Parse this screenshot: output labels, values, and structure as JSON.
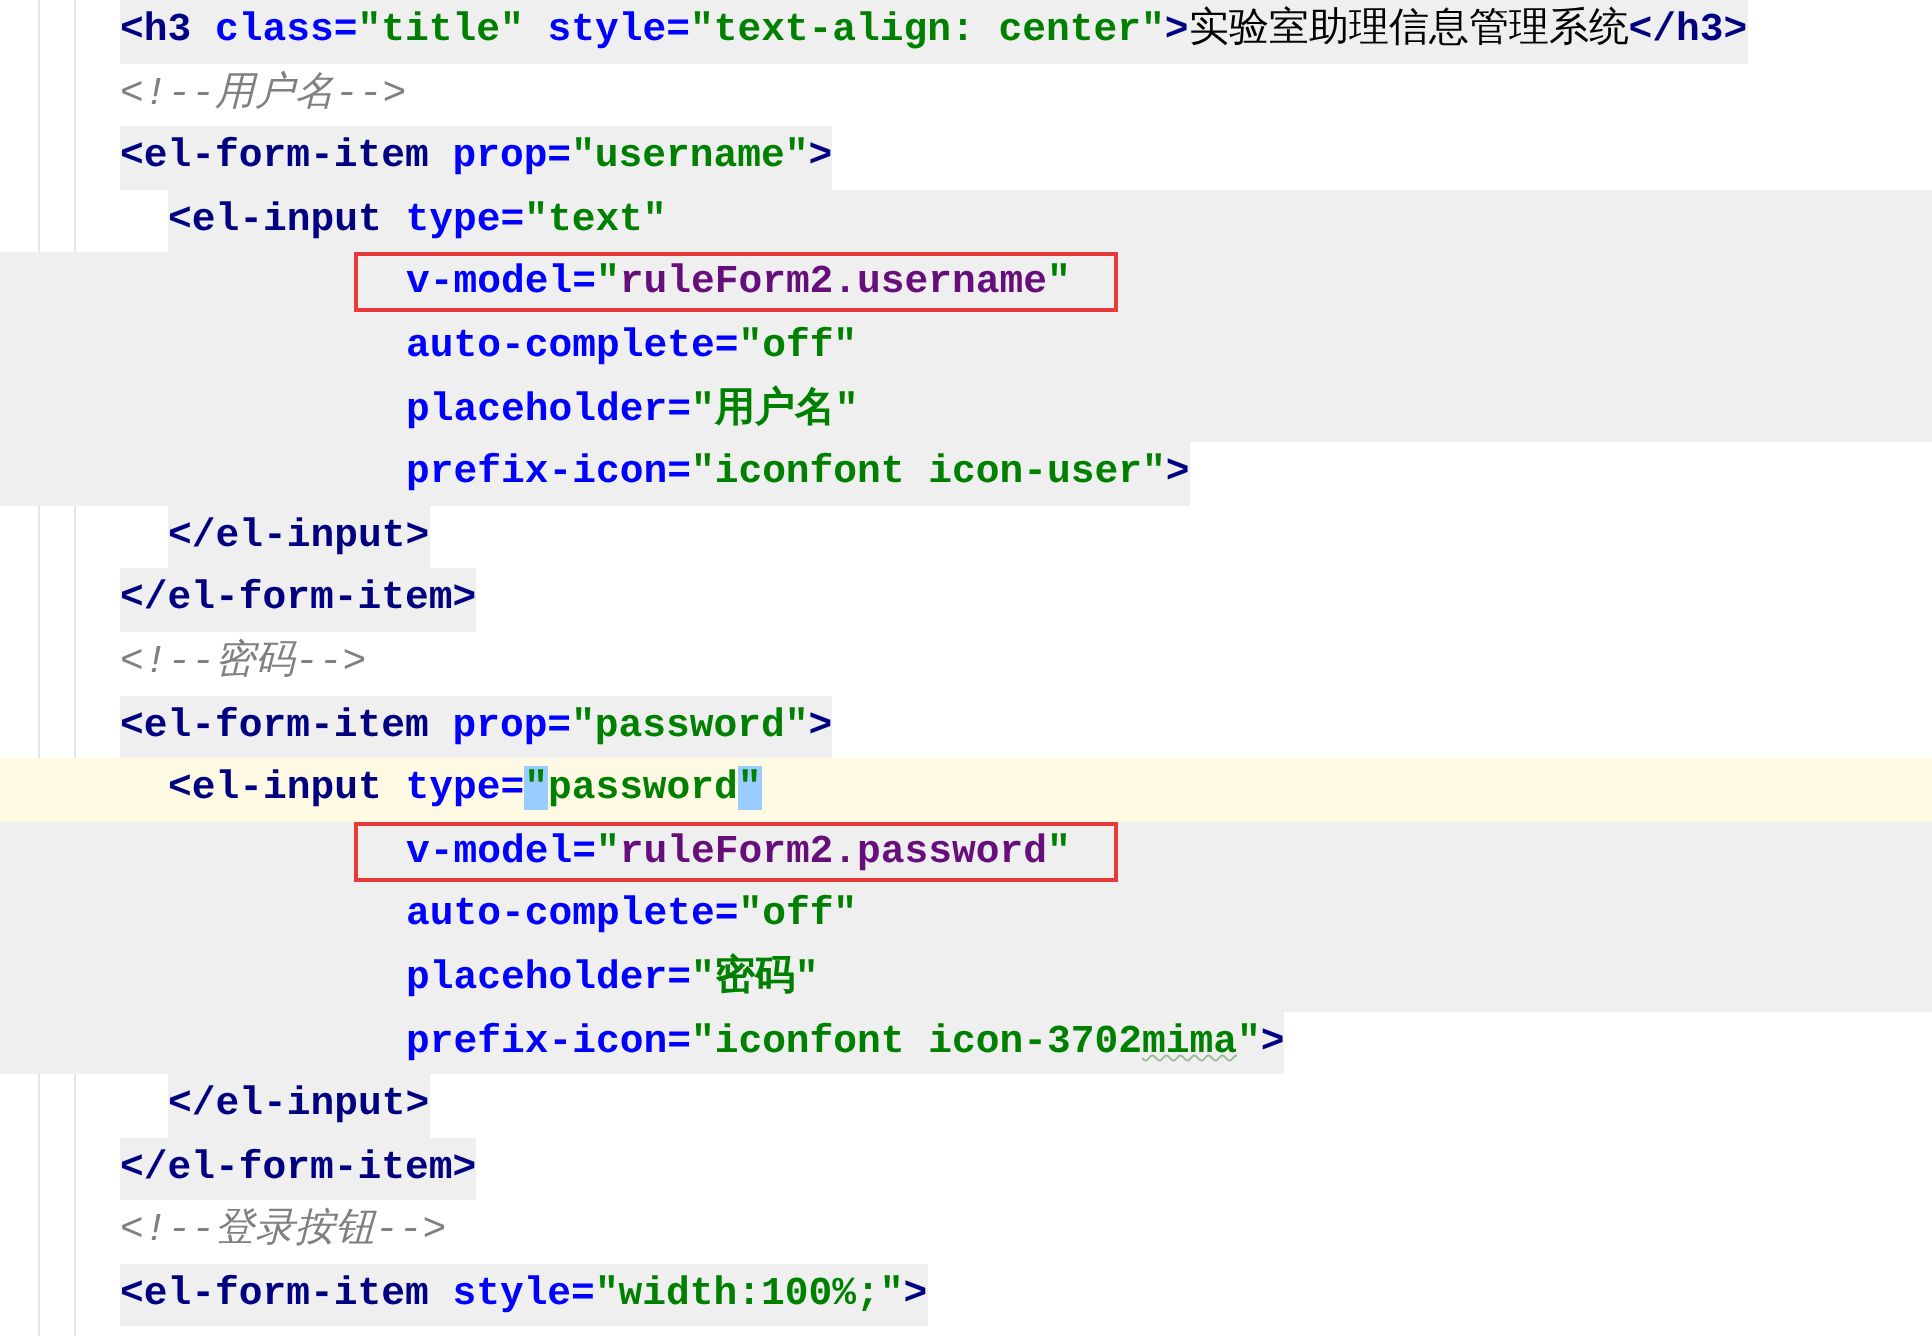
{
  "editor": {
    "lines": [
      {
        "kind": "top",
        "shaded": true,
        "current": false,
        "boxed": false,
        "tokens": [
          {
            "kind": "tag",
            "text": "<h3"
          },
          {
            "kind": "attr",
            "text": "class=",
            "space_before": true
          },
          {
            "kind": "value",
            "text": "\"title\""
          },
          {
            "kind": "attr",
            "text": "style=",
            "space_before": true
          },
          {
            "kind": "value",
            "text": "\"text-align: center\""
          },
          {
            "kind": "tag",
            "text": ">"
          },
          {
            "kind": "text",
            "text": "实验室助理信息管理系统"
          },
          {
            "kind": "tag",
            "text": "</h3>"
          }
        ]
      },
      {
        "kind": "top",
        "shaded": false,
        "current": false,
        "boxed": false,
        "tokens": [
          {
            "kind": "comment",
            "text": "<!--用户名-->"
          }
        ]
      },
      {
        "kind": "top",
        "shaded": true,
        "current": false,
        "boxed": false,
        "tokens": [
          {
            "kind": "tag",
            "text": "<el-form-item"
          },
          {
            "kind": "attr",
            "text": "prop=",
            "space_before": true
          },
          {
            "kind": "value",
            "text": "\"username\""
          },
          {
            "kind": "tag",
            "text": ">"
          }
        ]
      },
      {
        "kind": "child",
        "shaded": true,
        "current": false,
        "boxed": false,
        "tokens": [
          {
            "kind": "tag",
            "text": "<el-input"
          },
          {
            "kind": "attr",
            "text": "type=",
            "space_before": true
          },
          {
            "kind": "value",
            "text": "\"text\""
          }
        ]
      },
      {
        "kind": "attribute",
        "shaded": true,
        "current": false,
        "boxed": true,
        "tokens": [
          {
            "kind": "attr",
            "text": "v-model="
          },
          {
            "kind": "value",
            "text": "\""
          },
          {
            "kind": "expr",
            "text": "ruleForm2.username"
          },
          {
            "kind": "value",
            "text": "\""
          }
        ]
      },
      {
        "kind": "attribute",
        "shaded": true,
        "current": false,
        "boxed": false,
        "tokens": [
          {
            "kind": "attr",
            "text": "auto-complete="
          },
          {
            "kind": "value",
            "text": "\"off\""
          }
        ]
      },
      {
        "kind": "attribute",
        "shaded": true,
        "current": false,
        "boxed": false,
        "tokens": [
          {
            "kind": "attr",
            "text": "placeholder="
          },
          {
            "kind": "value",
            "text": "\"用户名\""
          }
        ]
      },
      {
        "kind": "attribute",
        "shaded": true,
        "current": false,
        "boxed": false,
        "tokens": [
          {
            "kind": "attr",
            "text": "prefix-icon="
          },
          {
            "kind": "value",
            "text": "\"iconfont icon-user\""
          },
          {
            "kind": "tag",
            "text": ">"
          }
        ]
      },
      {
        "kind": "child",
        "shaded": true,
        "current": false,
        "boxed": false,
        "tokens": [
          {
            "kind": "tag",
            "text": "</el-input>"
          }
        ]
      },
      {
        "kind": "top",
        "shaded": true,
        "current": false,
        "boxed": false,
        "tokens": [
          {
            "kind": "tag",
            "text": "</el-form-item>"
          }
        ]
      },
      {
        "kind": "top",
        "shaded": false,
        "current": false,
        "boxed": false,
        "tokens": [
          {
            "kind": "comment",
            "text": "<!--密码-->"
          }
        ]
      },
      {
        "kind": "top",
        "shaded": true,
        "current": false,
        "boxed": false,
        "tokens": [
          {
            "kind": "tag",
            "text": "<el-form-item"
          },
          {
            "kind": "attr",
            "text": "prop=",
            "space_before": true
          },
          {
            "kind": "value",
            "text": "\"password\""
          },
          {
            "kind": "tag",
            "text": ">"
          }
        ]
      },
      {
        "kind": "child",
        "shaded": false,
        "current": true,
        "boxed": false,
        "tokens": [
          {
            "kind": "tag",
            "text": "<el-input"
          },
          {
            "kind": "attr",
            "text": "type=",
            "space_before": true
          },
          {
            "kind": "value",
            "text": "\"",
            "matched": true
          },
          {
            "kind": "value",
            "text": "password"
          },
          {
            "kind": "value",
            "text": "\"",
            "matched": true
          }
        ]
      },
      {
        "kind": "attribute",
        "shaded": true,
        "current": false,
        "boxed": true,
        "tokens": [
          {
            "kind": "attr",
            "text": "v-model="
          },
          {
            "kind": "value",
            "text": "\""
          },
          {
            "kind": "expr",
            "text": "ruleForm2.password"
          },
          {
            "kind": "value",
            "text": "\""
          }
        ]
      },
      {
        "kind": "attribute",
        "shaded": true,
        "current": false,
        "boxed": false,
        "tokens": [
          {
            "kind": "attr",
            "text": "auto-complete="
          },
          {
            "kind": "value",
            "text": "\"off\""
          }
        ]
      },
      {
        "kind": "attribute",
        "shaded": true,
        "current": false,
        "boxed": false,
        "tokens": [
          {
            "kind": "attr",
            "text": "placeholder="
          },
          {
            "kind": "value",
            "text": "\"密码\""
          }
        ]
      },
      {
        "kind": "attribute",
        "shaded": true,
        "current": false,
        "boxed": false,
        "tokens": [
          {
            "kind": "attr",
            "text": "prefix-icon="
          },
          {
            "kind": "value",
            "text": "\"iconfont icon-3702"
          },
          {
            "kind": "value",
            "text": "mima",
            "typo": true
          },
          {
            "kind": "value",
            "text": "\""
          },
          {
            "kind": "tag",
            "text": ">"
          }
        ]
      },
      {
        "kind": "child",
        "shaded": true,
        "current": false,
        "boxed": false,
        "tokens": [
          {
            "kind": "tag",
            "text": "</el-input>"
          }
        ]
      },
      {
        "kind": "top",
        "shaded": true,
        "current": false,
        "boxed": false,
        "tokens": [
          {
            "kind": "tag",
            "text": "</el-form-item>"
          }
        ]
      },
      {
        "kind": "top",
        "shaded": false,
        "current": false,
        "boxed": false,
        "tokens": [
          {
            "kind": "comment",
            "text": "<!--登录按钮-->"
          }
        ]
      },
      {
        "kind": "top",
        "shaded": true,
        "current": false,
        "boxed": false,
        "tokens": [
          {
            "kind": "tag",
            "text": "<el-form-item"
          },
          {
            "kind": "attr",
            "text": "style=",
            "space_before": true
          },
          {
            "kind": "value",
            "text": "\"width:100%;\""
          },
          {
            "kind": "tag",
            "text": ">"
          }
        ]
      }
    ]
  }
}
